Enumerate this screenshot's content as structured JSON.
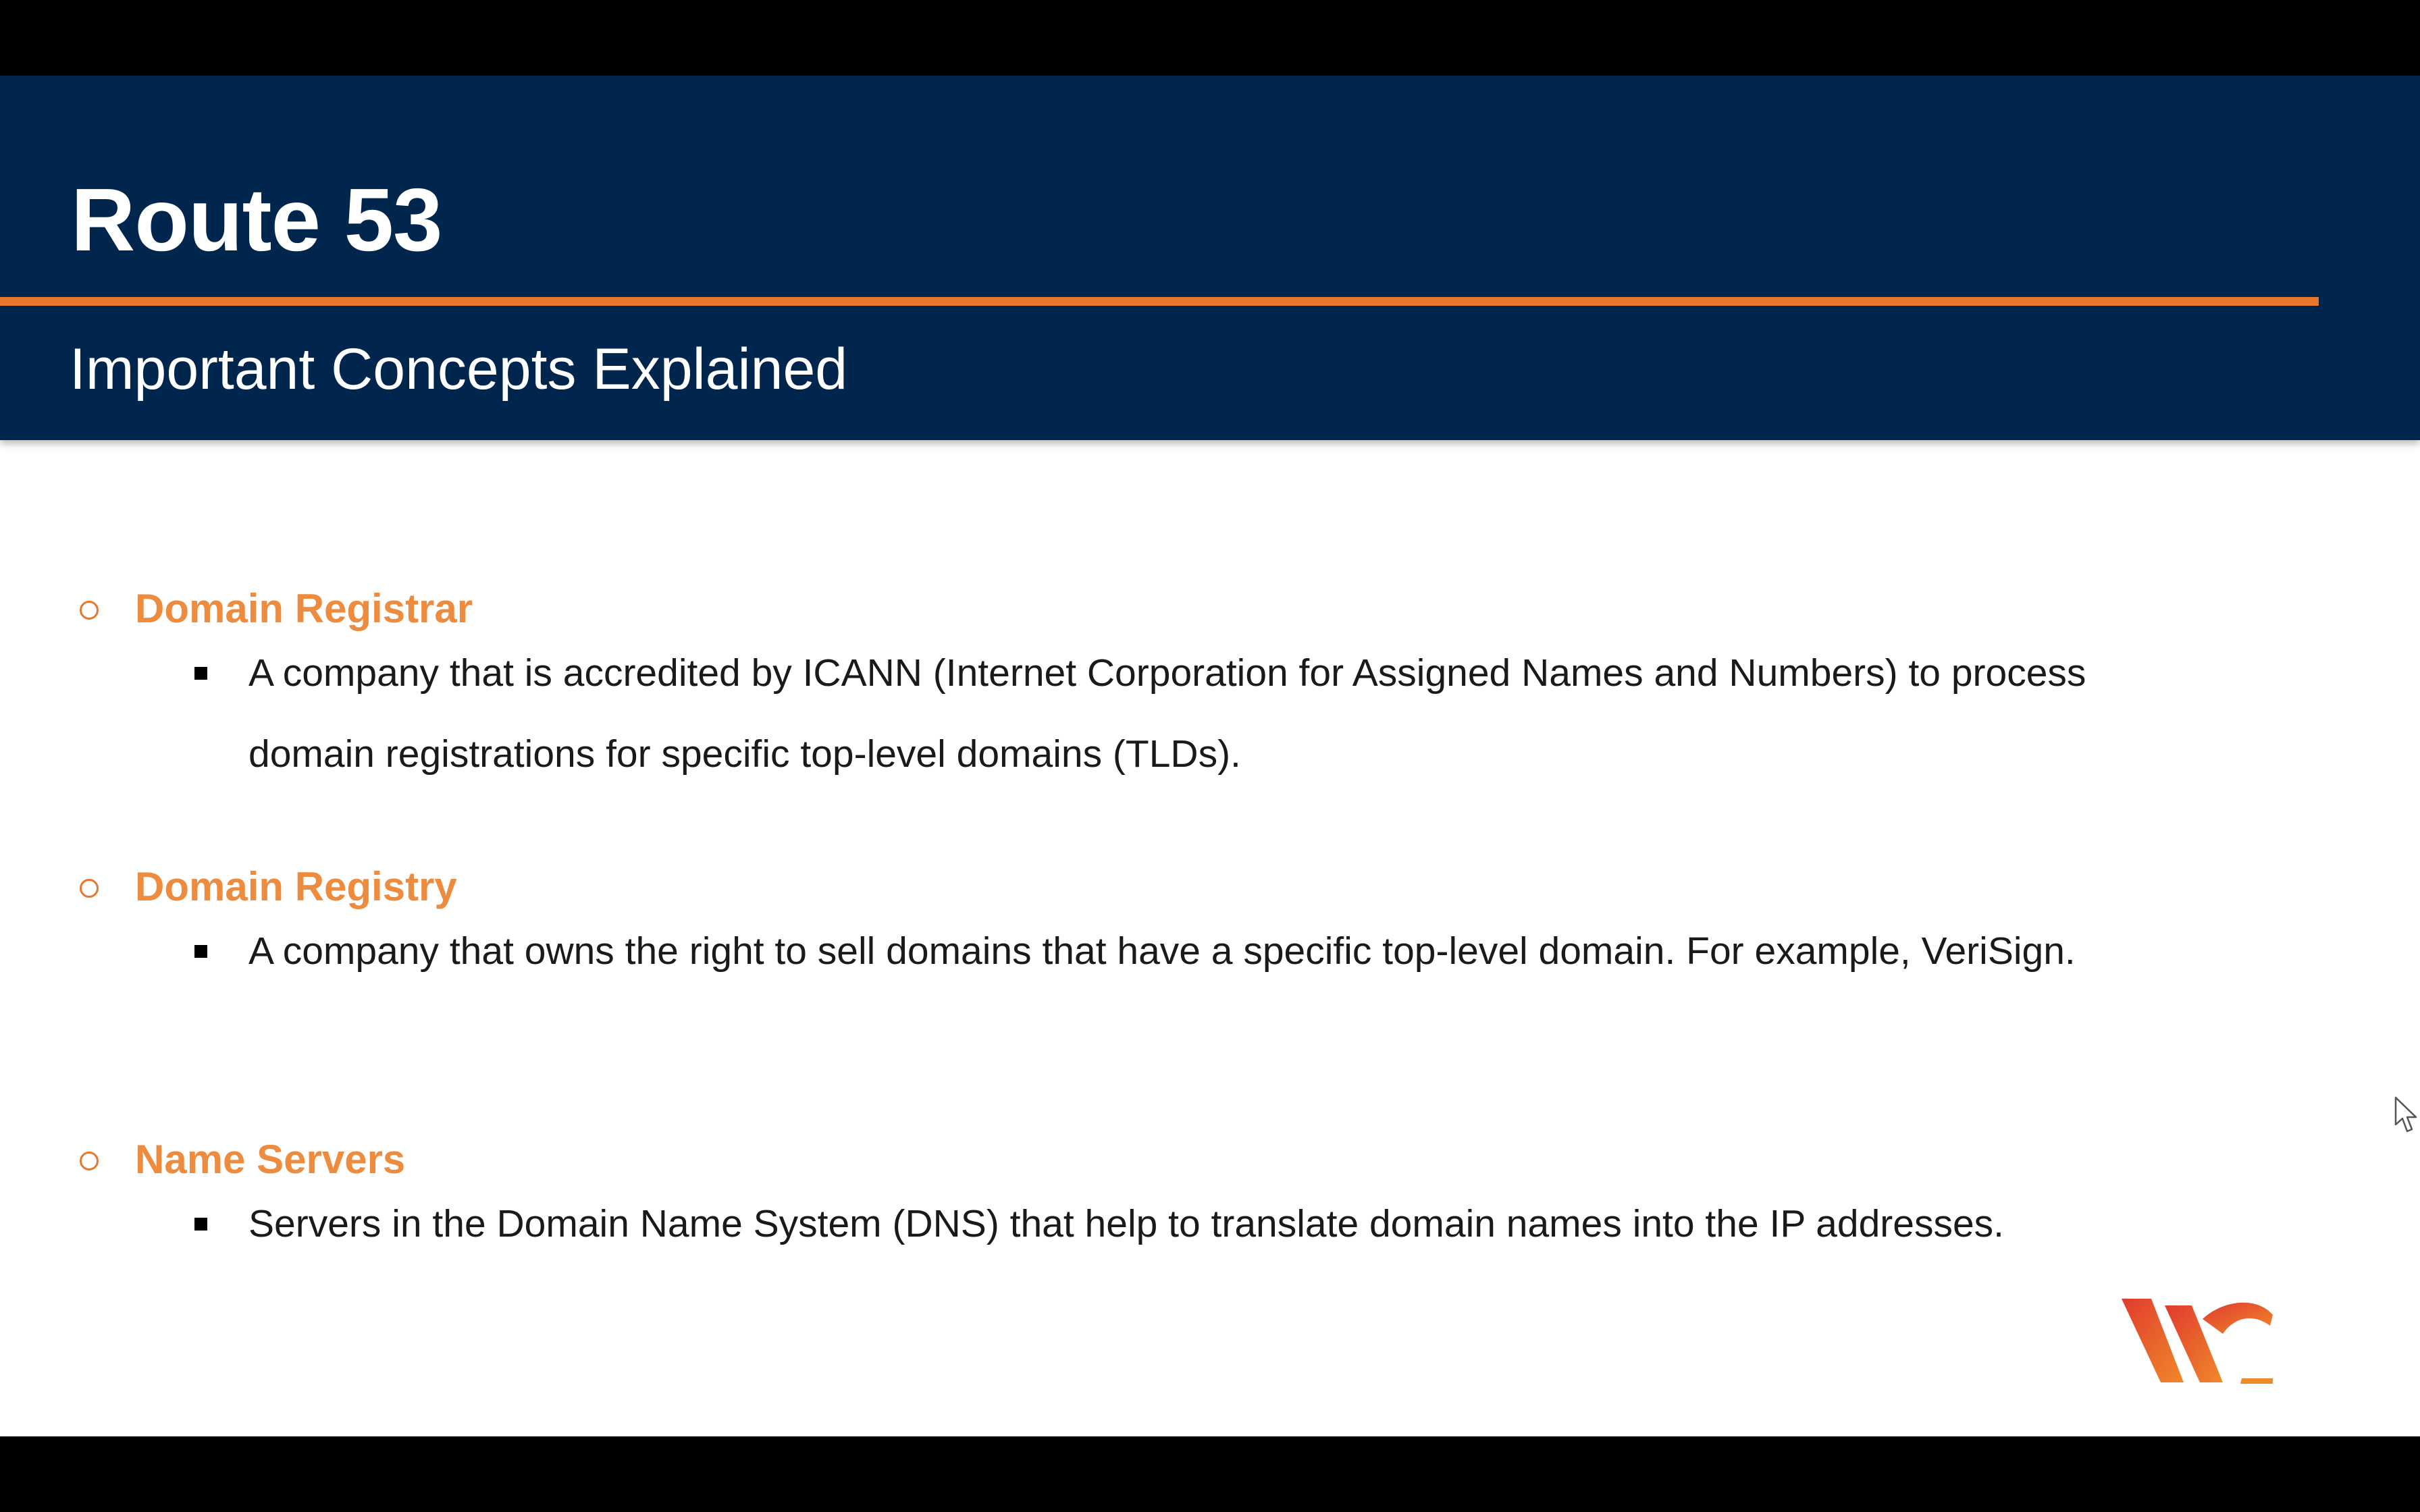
{
  "slide": {
    "title": "Route 53",
    "subtitle": "Important Concepts Explained",
    "concepts": [
      {
        "term": "Domain Registrar",
        "description": "A company that is accredited by ICANN (Internet Corporation for Assigned Names and Numbers) to process domain registrations for specific top-level domains (TLDs)."
      },
      {
        "term": "Domain Registry",
        "description": "A company that owns the right to sell domains that have a specific top-level domain. For example, VeriSign."
      },
      {
        "term": "Name Servers",
        "description": "Servers in the Domain Name System (DNS) that help to translate domain names into the IP addresses."
      }
    ]
  },
  "colors": {
    "header_bg": "#00264d",
    "accent_orange": "#e8772e",
    "term_orange": "#ed8b3e"
  },
  "icons": {
    "logo": "brand-logo-icon",
    "cursor": "mouse-pointer-icon"
  }
}
